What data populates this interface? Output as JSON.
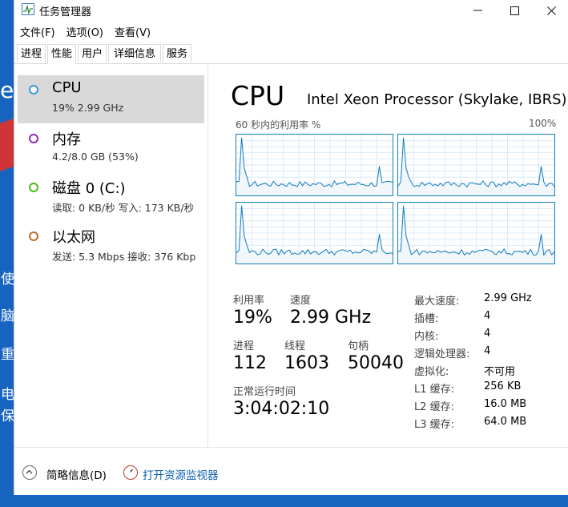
{
  "window": {
    "title": "任务管理器"
  },
  "desktop": {
    "glyphs": [
      "使",
      "脑",
      "重",
      "电",
      "保"
    ]
  },
  "menu": [
    "文件(F)",
    "选项(O)",
    "查看(V)"
  ],
  "tabs": [
    "进程",
    "性能",
    "用户",
    "详细信息",
    "服务"
  ],
  "sidebar": [
    {
      "title": "CPU",
      "sub": "19% 2.99 GHz",
      "color": "#3b9ad9"
    },
    {
      "title": "内存",
      "sub": "4.2/8.0 GB (53%)",
      "color": "#8b2fb0"
    },
    {
      "title": "磁盘 0 (C:)",
      "sub": "读取: 0 KB/秒 写入: 173 KB/秒",
      "color": "#4cbb17"
    },
    {
      "title": "以太网",
      "sub": "发送: 5.3 Mbps 接收: 376 Kbp",
      "color": "#b86e2a"
    }
  ],
  "main": {
    "title": "CPU",
    "model": "Intel Xeon Processor (Skylake, IBRS)",
    "graph_label": "60 秒内的利用率 %",
    "graph_max": "100%"
  },
  "stats": {
    "util_label": "利用率",
    "util": "19%",
    "speed_label": "速度",
    "speed": "2.99 GHz",
    "proc_label": "进程",
    "proc": "112",
    "thread_label": "线程",
    "thread": "1603",
    "handle_label": "句柄",
    "handle": "50040",
    "uptime_label": "正常运行时间",
    "uptime": "3:04:02:10"
  },
  "specs": [
    {
      "label": "最大速度:",
      "value": "2.99 GHz"
    },
    {
      "label": "插槽:",
      "value": "4"
    },
    {
      "label": "内核:",
      "value": "4"
    },
    {
      "label": "逻辑处理器:",
      "value": "4"
    },
    {
      "label": "虚拟化:",
      "value": "不可用"
    },
    {
      "label": "L1 缓存:",
      "value": "256 KB"
    },
    {
      "label": "L2 缓存:",
      "value": "16.0 MB"
    },
    {
      "label": "L3 缓存:",
      "value": "64.0 MB"
    }
  ],
  "footer": {
    "summary": "简略信息(D)",
    "monitor": "打开资源监视器"
  }
}
